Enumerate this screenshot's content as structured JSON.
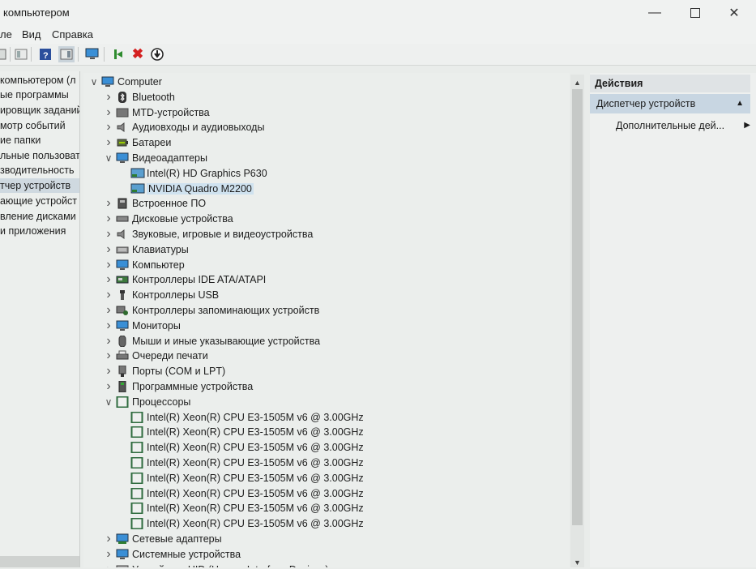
{
  "window": {
    "title": "компьютером"
  },
  "menu": [
    "ле",
    "Вид",
    "Справка"
  ],
  "left_pane": {
    "items": [
      "компьютером (л",
      "ые программы",
      "ировщик заданий",
      "мотр событий",
      "ие папки",
      "льные пользовате",
      "зводительность",
      "тчер устройств",
      "ающие устройст",
      "вление дисками",
      "и приложения"
    ],
    "selected_index": 7
  },
  "tree": {
    "rows": [
      {
        "label": "Computer",
        "level": 0,
        "state": "expanded",
        "icon": "computer-icon"
      },
      {
        "label": "Bluetooth",
        "level": 1,
        "state": "collapsed",
        "icon": "bluetooth-icon"
      },
      {
        "label": "MTD-устройства",
        "level": 1,
        "state": "collapsed",
        "icon": "mtd-icon"
      },
      {
        "label": "Аудиовходы и аудиовыходы",
        "level": 1,
        "state": "collapsed",
        "icon": "speaker-icon"
      },
      {
        "label": "Батареи",
        "level": 1,
        "state": "collapsed",
        "icon": "battery-icon"
      },
      {
        "label": "Видеоадаптеры",
        "level": 1,
        "state": "expanded",
        "icon": "monitor-icon"
      },
      {
        "label": "Intel(R) HD Graphics P630",
        "level": 2,
        "state": "leaf",
        "icon": "display-adapter-icon"
      },
      {
        "label": "NVIDIA Quadro M2200",
        "level": 2,
        "state": "leaf",
        "icon": "display-adapter-icon",
        "selected": true
      },
      {
        "label": "Встроенное ПО",
        "level": 1,
        "state": "collapsed",
        "icon": "firmware-icon"
      },
      {
        "label": "Дисковые устройства",
        "level": 1,
        "state": "collapsed",
        "icon": "disk-icon"
      },
      {
        "label": "Звуковые, игровые и видеоустройства",
        "level": 1,
        "state": "collapsed",
        "icon": "speaker-icon"
      },
      {
        "label": "Клавиатуры",
        "level": 1,
        "state": "collapsed",
        "icon": "keyboard-icon"
      },
      {
        "label": "Компьютер",
        "level": 1,
        "state": "collapsed",
        "icon": "monitor-icon"
      },
      {
        "label": "Контроллеры IDE ATA/ATAPI",
        "level": 1,
        "state": "collapsed",
        "icon": "ide-controller-icon"
      },
      {
        "label": "Контроллеры USB",
        "level": 1,
        "state": "collapsed",
        "icon": "usb-icon"
      },
      {
        "label": "Контроллеры запоминающих устройств",
        "level": 1,
        "state": "collapsed",
        "icon": "storage-controller-icon"
      },
      {
        "label": "Мониторы",
        "level": 1,
        "state": "collapsed",
        "icon": "monitor-icon"
      },
      {
        "label": "Мыши и иные указывающие устройства",
        "level": 1,
        "state": "collapsed",
        "icon": "mouse-icon"
      },
      {
        "label": "Очереди печати",
        "level": 1,
        "state": "collapsed",
        "icon": "printer-icon"
      },
      {
        "label": "Порты (COM и LPT)",
        "level": 1,
        "state": "collapsed",
        "icon": "port-icon"
      },
      {
        "label": "Программные устройства",
        "level": 1,
        "state": "collapsed",
        "icon": "software-device-icon"
      },
      {
        "label": "Процессоры",
        "level": 1,
        "state": "expanded",
        "icon": "processor-icon"
      },
      {
        "label": "Intel(R) Xeon(R) CPU E3-1505M v6 @ 3.00GHz",
        "level": 2,
        "state": "leaf",
        "icon": "processor-icon"
      },
      {
        "label": "Intel(R) Xeon(R) CPU E3-1505M v6 @ 3.00GHz",
        "level": 2,
        "state": "leaf",
        "icon": "processor-icon"
      },
      {
        "label": "Intel(R) Xeon(R) CPU E3-1505M v6 @ 3.00GHz",
        "level": 2,
        "state": "leaf",
        "icon": "processor-icon"
      },
      {
        "label": "Intel(R) Xeon(R) CPU E3-1505M v6 @ 3.00GHz",
        "level": 2,
        "state": "leaf",
        "icon": "processor-icon"
      },
      {
        "label": "Intel(R) Xeon(R) CPU E3-1505M v6 @ 3.00GHz",
        "level": 2,
        "state": "leaf",
        "icon": "processor-icon"
      },
      {
        "label": "Intel(R) Xeon(R) CPU E3-1505M v6 @ 3.00GHz",
        "level": 2,
        "state": "leaf",
        "icon": "processor-icon"
      },
      {
        "label": "Intel(R) Xeon(R) CPU E3-1505M v6 @ 3.00GHz",
        "level": 2,
        "state": "leaf",
        "icon": "processor-icon"
      },
      {
        "label": "Intel(R) Xeon(R) CPU E3-1505M v6 @ 3.00GHz",
        "level": 2,
        "state": "leaf",
        "icon": "processor-icon"
      },
      {
        "label": "Сетевые адаптеры",
        "level": 1,
        "state": "collapsed",
        "icon": "network-adapter-icon"
      },
      {
        "label": "Системные устройства",
        "level": 1,
        "state": "collapsed",
        "icon": "system-device-icon"
      },
      {
        "label": "Устройства HID (Human Interface Devices)",
        "level": 1,
        "state": "collapsed",
        "icon": "hid-icon"
      }
    ]
  },
  "actions": {
    "header": "Действия",
    "section": "Диспетчер устройств",
    "more": "Дополнительные дей..."
  },
  "colors": {
    "selection": "#cfe2ef",
    "actions_section": "#c8d6e2",
    "monitor_blue": "#3a8fd6",
    "delete_red": "#d42020",
    "enable_green": "#2e8b2e"
  }
}
